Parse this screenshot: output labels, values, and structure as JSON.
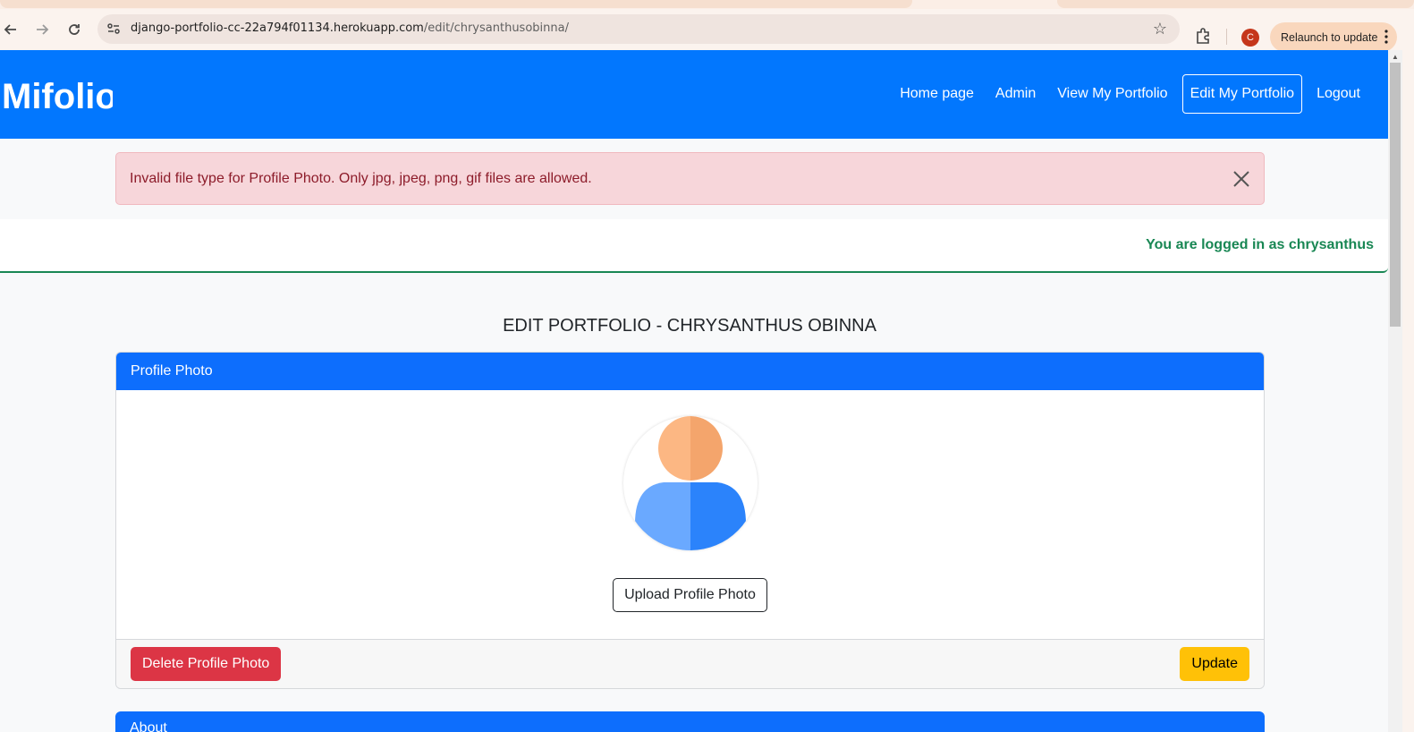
{
  "browser": {
    "url_host": "django-portfolio-cc-22a794f01134.herokuapp.com",
    "url_path": "/edit/chrysanthusobinna/",
    "profile_initial": "C",
    "relaunch_label": "Relaunch to update"
  },
  "navbar": {
    "brand": "Mifolio",
    "links": [
      {
        "label": "Home page"
      },
      {
        "label": "Admin"
      },
      {
        "label": "View My Portfolio"
      },
      {
        "label": "Edit My Portfolio"
      },
      {
        "label": "Logout"
      }
    ]
  },
  "alert": {
    "message": "Invalid file type for Profile Photo. Only jpg, jpeg, png, gif files are allowed."
  },
  "session": {
    "logged_in_text": "You are logged in as chrysanthus"
  },
  "page": {
    "heading": "EDIT PORTFOLIO - CHRYSANTHUS OBINNA"
  },
  "profile_card": {
    "title": "Profile Photo",
    "upload_label": "Upload Profile Photo",
    "delete_label": "Delete Profile Photo",
    "update_label": "Update"
  },
  "next_card": {
    "title": "About"
  },
  "colors": {
    "navbar": "#0277fe",
    "primary": "#0d6efd",
    "danger": "#dc3545",
    "warning": "#ffc107",
    "success": "#198754",
    "alert_bg": "#f7d6da"
  }
}
